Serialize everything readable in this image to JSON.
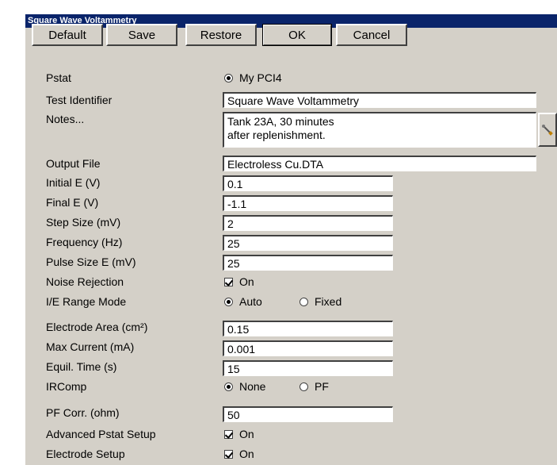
{
  "window": {
    "title": "Square Wave Voltammetry"
  },
  "toolbar": {
    "default_label": "Default",
    "save_label": "Save",
    "restore_label": "Restore",
    "ok_label": "OK",
    "cancel_label": "Cancel"
  },
  "form": {
    "pstat": {
      "label": "Pstat",
      "option": "My PCI4",
      "selected": true
    },
    "test_identifier": {
      "label": "Test Identifier",
      "value": "Square Wave Voltammetry"
    },
    "notes": {
      "label": "Notes...",
      "value": "Tank 23A, 30 minutes\nafter replenishment.",
      "edit_icon": "wrench-icon"
    },
    "output_file": {
      "label": "Output File",
      "value": "Electroless Cu.DTA"
    },
    "initial_e": {
      "label": "Initial E (V)",
      "value": "0.1"
    },
    "final_e": {
      "label": "Final E (V)",
      "value": "-1.1"
    },
    "step_size": {
      "label": "Step Size (mV)",
      "value": "2"
    },
    "frequency": {
      "label": "Frequency (Hz)",
      "value": "25"
    },
    "pulse_size": {
      "label": "Pulse Size E (mV)",
      "value": "25"
    },
    "noise_rejection": {
      "label": "Noise Rejection",
      "option": "On",
      "checked": true
    },
    "ie_range_mode": {
      "label": "I/E Range Mode",
      "options": [
        "Auto",
        "Fixed"
      ],
      "selected": "Auto"
    },
    "electrode_area": {
      "label": "Electrode Area (cm²)",
      "value": "0.15"
    },
    "max_current": {
      "label": "Max Current (mA)",
      "value": "0.001"
    },
    "equil_time": {
      "label": "Equil. Time (s)",
      "value": "15"
    },
    "ircomp": {
      "label": "IRComp",
      "options": [
        "None",
        "PF"
      ],
      "selected": "None"
    },
    "pf_corr": {
      "label": "PF Corr. (ohm)",
      "value": "50"
    },
    "advanced_pstat_setup": {
      "label": "Advanced Pstat Setup",
      "option": "On",
      "checked": true
    },
    "electrode_setup": {
      "label": "Electrode Setup",
      "option": "On",
      "checked": true
    }
  },
  "colors": {
    "titlebar": "#0a246a",
    "face": "#d4d0c8",
    "field": "#ffffff"
  }
}
